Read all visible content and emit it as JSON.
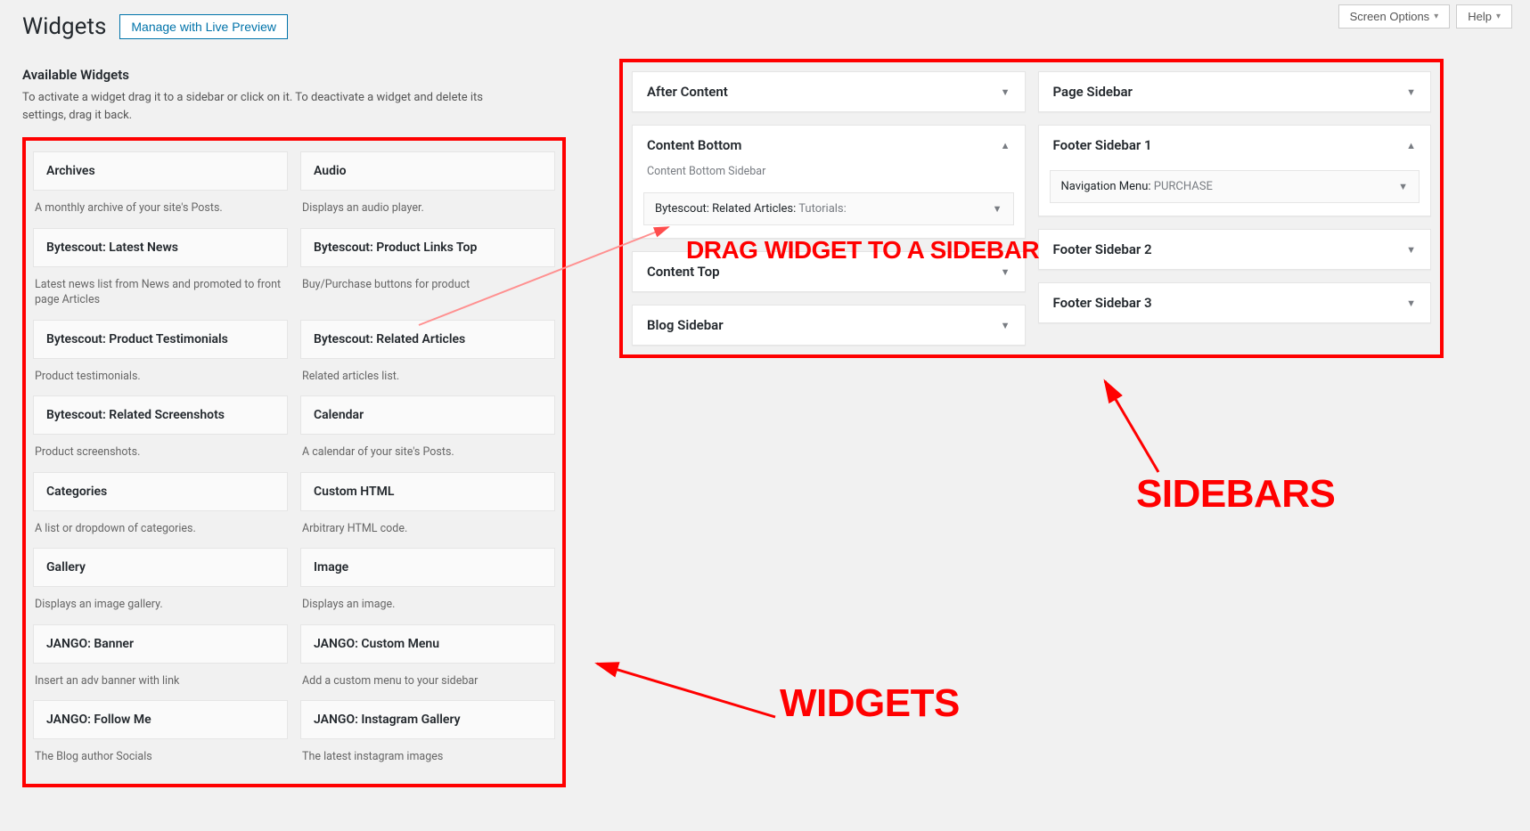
{
  "header": {
    "page_title": "Widgets",
    "live_preview": "Manage with Live Preview",
    "screen_options": "Screen Options",
    "help": "Help"
  },
  "available": {
    "title": "Available Widgets",
    "desc": "To activate a widget drag it to a sidebar or click on it. To deactivate a widget and delete its settings, drag it back."
  },
  "widgets": [
    {
      "title": "Archives",
      "desc": "A monthly archive of your site's Posts."
    },
    {
      "title": "Audio",
      "desc": "Displays an audio player."
    },
    {
      "title": "Bytescout: Latest News",
      "desc": "Latest news list from News and promoted to front page Articles"
    },
    {
      "title": "Bytescout: Product Links Top",
      "desc": "Buy/Purchase buttons for product"
    },
    {
      "title": "Bytescout: Product Testimonials",
      "desc": "Product testimonials."
    },
    {
      "title": "Bytescout: Related Articles",
      "desc": "Related articles list."
    },
    {
      "title": "Bytescout: Related Screenshots",
      "desc": "Product screenshots."
    },
    {
      "title": "Calendar",
      "desc": "A calendar of your site's Posts."
    },
    {
      "title": "Categories",
      "desc": "A list or dropdown of categories."
    },
    {
      "title": "Custom HTML",
      "desc": "Arbitrary HTML code."
    },
    {
      "title": "Gallery",
      "desc": "Displays an image gallery."
    },
    {
      "title": "Image",
      "desc": "Displays an image."
    },
    {
      "title": "JANGO: Banner",
      "desc": "Insert an adv banner with link"
    },
    {
      "title": "JANGO: Custom Menu",
      "desc": "Add a custom menu to your sidebar"
    },
    {
      "title": "JANGO: Follow Me",
      "desc": "The Blog author Socials"
    },
    {
      "title": "JANGO: Instagram Gallery",
      "desc": "The latest instagram images"
    }
  ],
  "sidebars": {
    "left": [
      {
        "title": "After Content",
        "expanded": false
      },
      {
        "title": "Content Bottom",
        "expanded": true,
        "desc": "Content Bottom Sidebar",
        "items": [
          {
            "name": "Bytescout: Related Articles:",
            "sub": "Tutorials:"
          }
        ]
      },
      {
        "title": "Content Top",
        "expanded": false
      },
      {
        "title": "Blog Sidebar",
        "expanded": false
      }
    ],
    "right": [
      {
        "title": "Page Sidebar",
        "expanded": false
      },
      {
        "title": "Footer Sidebar 1",
        "expanded": true,
        "items": [
          {
            "name": "Navigation Menu:",
            "sub": "PURCHASE"
          }
        ]
      },
      {
        "title": "Footer Sidebar 2",
        "expanded": false
      },
      {
        "title": "Footer Sidebar 3",
        "expanded": false
      }
    ]
  },
  "annotations": {
    "drag": "DRAG WIDGET TO A SIDEBAR",
    "widgets": "WIDGETS",
    "sidebars": "SIDEBARS"
  }
}
